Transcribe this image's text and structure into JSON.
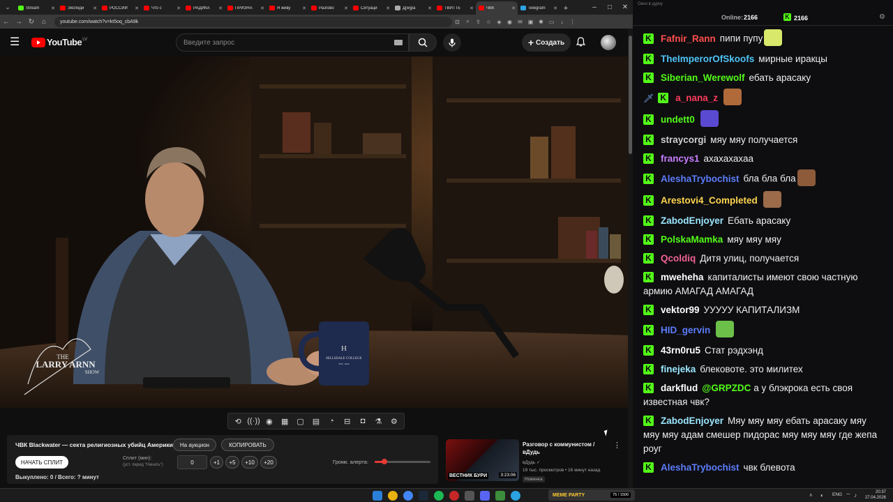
{
  "browser": {
    "tabs": [
      {
        "label": "Stream",
        "color": "#53fc18",
        "active": false
      },
      {
        "label": "Экспеди",
        "color": "#ff0000",
        "active": false
      },
      {
        "label": "РОССИЙ",
        "color": "#ff0000",
        "active": false
      },
      {
        "label": "Что с",
        "color": "#ff0000",
        "active": false
      },
      {
        "label": "РАДИКА",
        "color": "#ff0000",
        "active": false
      },
      {
        "label": "ПРИЗНА",
        "color": "#ff0000",
        "active": false
      },
      {
        "label": "Я живу",
        "color": "#ff0000",
        "active": false
      },
      {
        "label": "Разгово",
        "color": "#ff0000",
        "active": false
      },
      {
        "label": "Ситуаци",
        "color": "#ff0000",
        "active": false
      },
      {
        "label": "Д[w]ра",
        "color": "#aaaaaa",
        "active": false
      },
      {
        "label": "ТВИТТЕ",
        "color": "#ff0000",
        "active": false
      },
      {
        "label": "ЧВК",
        "color": "#ff0000",
        "active": true
      },
      {
        "label": "Telegram",
        "color": "#2aa3e0",
        "active": false
      }
    ],
    "url": "youtube.com/watch?v=kt5oq_cbA9k"
  },
  "youtube": {
    "logo_text": "YouTube",
    "country_code": "LV",
    "search_placeholder": "Введите запрос",
    "create_label": "Создать"
  },
  "video": {
    "watermark_top": "THE",
    "watermark_main": "LARRY ARNN",
    "watermark_bottom": "SHOW",
    "mug_text": "HILLSDALE COLLEGE",
    "mug_letter": "H",
    "mug_est": "EST. 1844"
  },
  "ext_panel": {
    "title": "ЧВК Blackwater — секта религиозных убийц Америки!",
    "auction_label": "На аукцион",
    "copy_label": "КОПИРОВАТЬ",
    "start_split_label": "НАЧАТЬ СПЛИТ",
    "split_label": "Сплит (мин):",
    "split_hint": "(уст. перед \"Начать\")",
    "split_value": "0",
    "increments": [
      "+1",
      "+5",
      "+10",
      "+20"
    ],
    "volume_label": "Громк. алерта:",
    "volume_fraction": 0.17,
    "bought_label": "Выкуплено: 0 / Всего: ? минут"
  },
  "recommendation": {
    "title": "Разговор с коммунистом / вДудь",
    "channel": "вДудь",
    "meta": "19 тыс. просмотров • 16 минут назад",
    "badge": "Новинка",
    "duration": "3:23:06",
    "thumb_label": "ВЕСТНИК БУРИ"
  },
  "chat": {
    "window_title": "Окно в дурку",
    "online_label": "Online:",
    "online_count": "2166",
    "kick_count": "2166",
    "messages": [
      {
        "user": "Fafnir_Rann",
        "color": "#ff4d4d",
        "text": "пипи пупу",
        "emote": "#d8e86a"
      },
      {
        "user": "TheImperorOfSkoofs",
        "color": "#4fc3f7",
        "text": "мирные иракцы"
      },
      {
        "user": "Siberian_Werewolf",
        "color": "#53fc18",
        "text": "ебать арасаку"
      },
      {
        "user": "a_nana_z",
        "color": "#ff3b5c",
        "text": "",
        "sword": true,
        "emote": "#b06a3a"
      },
      {
        "user": "undett0",
        "color": "#53fc18",
        "text": "",
        "emote": "#5a4ad1"
      },
      {
        "user": "straycorgi",
        "color": "#cfcfcf",
        "text": "мяу мяу получается"
      },
      {
        "user": "francys1",
        "color": "#c77dff",
        "text": "ахахахахаа"
      },
      {
        "user": "AleshaTrybochist",
        "color": "#5c7cfa",
        "text": "бла бла бла",
        "emote": "#8d5a3a"
      },
      {
        "user": "Arestovi4_Completed",
        "color": "#ffd54f",
        "text": "",
        "emote": "#9c6b4a"
      },
      {
        "user": "ZabodEnjoyer",
        "color": "#9be7ff",
        "text": "Ебать арасаку"
      },
      {
        "user": "PolskaMamka",
        "color": "#53fc18",
        "text": "мяу мяу мяу"
      },
      {
        "user": "Qcoldiq",
        "color": "#f06292",
        "text": "Дитя улиц, получается"
      },
      {
        "user": "mweheha",
        "color": "#ffffff",
        "text": "капиталисты имеют свою частную армию АМАГАД АМАГАД"
      },
      {
        "user": "vektor99",
        "color": "#ffffff",
        "text": "УУУУУ КАПИТАЛИЗМ"
      },
      {
        "user": "HID_gervin",
        "color": "#5c7cfa",
        "text": "",
        "emote": "#6cc04a"
      },
      {
        "user": "43rn0ru5",
        "color": "#ffffff",
        "text": "Стат рэдхэнд"
      },
      {
        "user": "finejeka",
        "color": "#9be7ff",
        "text": "блековоте. это милитех"
      },
      {
        "user": "darkflud",
        "color": "#ffffff",
        "text": "а у блэкрока есть своя известная чвк?",
        "mention": "@GRPZDC"
      },
      {
        "user": "ZabodEnjoyer",
        "color": "#9be7ff",
        "text": "Мяу мяу мяу ебать арасаку мяу мяу мяу адам смешер пидорас мяу мяу мяу где жепа роуг"
      },
      {
        "user": "AleshaTrybochist",
        "color": "#5c7cfa",
        "text": "чвк блевота"
      }
    ]
  },
  "taskbar": {
    "meme_label": "MEME PARTY",
    "meme_value": "75 / 1500",
    "lang": "ENG",
    "time": "20:37",
    "date": "27.04.2026"
  }
}
